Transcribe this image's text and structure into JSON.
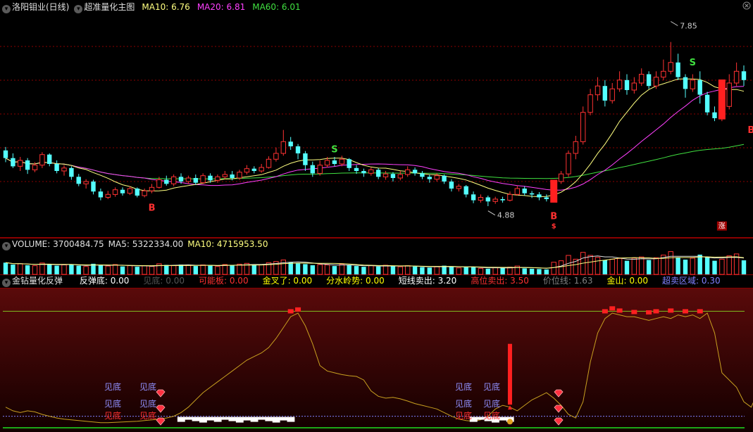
{
  "main_header": {
    "stock": "洛阳钼业(日线)",
    "indicator": "超准量化主图",
    "ma10": "MA10: 6.76",
    "ma20": "MA20: 6.81",
    "ma60": "MA60: 6.01"
  },
  "volume_header": {
    "volume": "VOLUME: 3700484.75",
    "ma5": "MA5: 5322334.00",
    "ma10": "MA10: 4715953.50"
  },
  "osc_header": {
    "name": "金钻量化反弹",
    "items": [
      {
        "label": "反弹底: 0.00",
        "color": "#ffffff"
      },
      {
        "label": "见底: 0.00",
        "color": "#555555"
      },
      {
        "label": "可能板: 0.00",
        "color": "#ff3030"
      },
      {
        "label": "金叉了: 0.00",
        "color": "#ffff00"
      },
      {
        "label": "分水岭势: 0.00",
        "color": "#ffff00"
      },
      {
        "label": "短线卖出: 3.20",
        "color": "#ffffff"
      },
      {
        "label": "高位卖出: 3.50",
        "color": "#ff3030"
      },
      {
        "label": "价位线: 1.63",
        "color": "#808080"
      },
      {
        "label": "金山: 0.00",
        "color": "#ffff00"
      },
      {
        "label": "超卖区域: 0.30",
        "color": "#8080ff"
      }
    ]
  },
  "colors": {
    "up": "#ff3232",
    "down": "#54ffff",
    "ma10": "#ffff80",
    "ma20": "#ff40ff",
    "ma60": "#40e040",
    "grid": "#8b0000"
  },
  "chart_data": {
    "type": "candlestick",
    "high_label": "7.85",
    "low_label": "4.88",
    "signals": {
      "buy": "B",
      "sell": "S",
      "small_sell": "$",
      "zhang": "涨"
    },
    "osc_labels": {
      "jiandi": "见底"
    },
    "candles": [
      [
        5.75,
        5.62,
        5.81,
        5.55
      ],
      [
        5.62,
        5.48,
        5.7,
        5.45
      ],
      [
        5.48,
        5.58,
        5.64,
        5.4
      ],
      [
        5.58,
        5.42,
        5.62,
        5.35
      ],
      [
        5.42,
        5.5,
        5.55,
        5.38
      ],
      [
        5.5,
        5.68,
        5.72,
        5.45
      ],
      [
        5.68,
        5.52,
        5.7,
        5.48
      ],
      [
        5.52,
        5.4,
        5.58,
        5.36
      ],
      [
        5.4,
        5.45,
        5.5,
        5.32
      ],
      [
        5.45,
        5.3,
        5.48,
        5.25
      ],
      [
        5.3,
        5.18,
        5.35,
        5.14
      ],
      [
        5.18,
        5.22,
        5.26,
        5.1
      ],
      [
        5.22,
        5.05,
        5.25,
        5.0
      ],
      [
        5.05,
        4.95,
        5.1,
        4.9
      ],
      [
        4.95,
        5.0,
        5.06,
        4.92
      ],
      [
        5.0,
        5.08,
        5.12,
        4.96
      ],
      [
        5.08,
        5.02,
        5.12,
        4.98
      ],
      [
        5.02,
        5.1,
        5.14,
        4.99
      ],
      [
        5.1,
        4.98,
        5.12,
        4.95
      ],
      [
        4.98,
        5.06,
        5.1,
        4.95
      ],
      [
        5.06,
        5.12,
        5.18,
        5.02
      ],
      [
        5.12,
        5.25,
        5.3,
        5.1
      ],
      [
        5.25,
        5.18,
        5.32,
        5.15
      ],
      [
        5.18,
        5.3,
        5.34,
        5.14
      ],
      [
        5.3,
        5.22,
        5.36,
        5.18
      ],
      [
        5.22,
        5.28,
        5.32,
        5.18
      ],
      [
        5.28,
        5.2,
        5.34,
        5.16
      ],
      [
        5.2,
        5.32,
        5.36,
        5.18
      ],
      [
        5.32,
        5.24,
        5.36,
        5.2
      ],
      [
        5.24,
        5.3,
        5.34,
        5.2
      ],
      [
        5.3,
        5.34,
        5.4,
        5.26
      ],
      [
        5.34,
        5.28,
        5.4,
        5.24
      ],
      [
        5.28,
        5.38,
        5.42,
        5.25
      ],
      [
        5.38,
        5.44,
        5.5,
        5.34
      ],
      [
        5.44,
        5.4,
        5.48,
        5.36
      ],
      [
        5.4,
        5.46,
        5.52,
        5.37
      ],
      [
        5.46,
        5.6,
        5.65,
        5.44
      ],
      [
        5.6,
        5.7,
        5.8,
        5.56
      ],
      [
        5.7,
        5.9,
        6.1,
        5.66
      ],
      [
        5.9,
        5.82,
        5.98,
        5.76
      ],
      [
        5.82,
        5.7,
        5.86,
        5.6
      ],
      [
        5.7,
        5.5,
        5.74,
        5.4
      ],
      [
        5.5,
        5.36,
        5.56,
        5.3
      ],
      [
        5.36,
        5.5,
        5.58,
        5.32
      ],
      [
        5.5,
        5.58,
        5.64,
        5.46
      ],
      [
        5.58,
        5.52,
        5.64,
        5.48
      ],
      [
        5.52,
        5.6,
        5.66,
        5.48
      ],
      [
        5.6,
        5.45,
        5.62,
        5.4
      ],
      [
        5.45,
        5.4,
        5.5,
        5.35
      ],
      [
        5.4,
        5.36,
        5.44,
        5.3
      ],
      [
        5.36,
        5.42,
        5.46,
        5.32
      ],
      [
        5.42,
        5.3,
        5.45,
        5.26
      ],
      [
        5.3,
        5.35,
        5.4,
        5.25
      ],
      [
        5.35,
        5.28,
        5.38,
        5.22
      ],
      [
        5.28,
        5.34,
        5.4,
        5.24
      ],
      [
        5.34,
        5.42,
        5.48,
        5.3
      ],
      [
        5.42,
        5.36,
        5.46,
        5.32
      ],
      [
        5.36,
        5.3,
        5.4,
        5.26
      ],
      [
        5.3,
        5.26,
        5.34,
        5.2
      ],
      [
        5.26,
        5.32,
        5.36,
        5.22
      ],
      [
        5.32,
        5.22,
        5.34,
        5.18
      ],
      [
        5.22,
        5.1,
        5.26,
        5.05
      ],
      [
        5.1,
        5.14,
        5.18,
        5.05
      ],
      [
        5.14,
        5.0,
        5.16,
        4.95
      ],
      [
        5.0,
        4.9,
        5.05,
        4.85
      ],
      [
        4.9,
        4.95,
        5.0,
        4.86
      ],
      [
        4.95,
        4.88,
        4.98,
        4.8
      ],
      [
        4.88,
        4.92,
        4.96,
        4.84
      ],
      [
        4.92,
        4.9,
        4.96,
        4.86
      ],
      [
        4.9,
        5.0,
        5.05,
        4.88
      ],
      [
        5.0,
        5.1,
        5.15,
        4.98
      ],
      [
        5.1,
        5.02,
        5.14,
        4.98
      ],
      [
        5.02,
        5.0,
        5.06,
        4.94
      ],
      [
        5.0,
        4.95,
        5.04,
        4.9
      ],
      [
        4.95,
        4.92,
        5.0,
        4.88
      ],
      [
        4.92,
        5.22,
        5.25,
        4.9
      ],
      [
        5.22,
        5.35,
        5.4,
        5.18
      ],
      [
        5.35,
        5.7,
        5.75,
        5.3
      ],
      [
        5.7,
        5.9,
        6.0,
        5.6
      ],
      [
        5.9,
        6.4,
        6.5,
        5.85
      ],
      [
        6.4,
        6.7,
        6.8,
        6.35
      ],
      [
        6.7,
        6.85,
        7.0,
        6.6
      ],
      [
        6.85,
        6.6,
        6.95,
        6.5
      ],
      [
        6.6,
        6.8,
        6.9,
        6.55
      ],
      [
        6.8,
        6.95,
        7.1,
        6.75
      ],
      [
        6.95,
        6.78,
        7.05,
        6.7
      ],
      [
        6.78,
        6.9,
        7.0,
        6.72
      ],
      [
        6.9,
        7.05,
        7.15,
        6.85
      ],
      [
        7.05,
        6.85,
        7.1,
        6.8
      ],
      [
        6.85,
        7.0,
        7.1,
        6.8
      ],
      [
        7.0,
        7.1,
        7.3,
        6.95
      ],
      [
        7.1,
        7.25,
        7.6,
        7.05
      ],
      [
        7.25,
        7.0,
        7.4,
        6.95
      ],
      [
        7.0,
        6.8,
        7.05,
        6.65
      ],
      [
        6.8,
        6.95,
        7.05,
        6.75
      ],
      [
        6.95,
        6.7,
        7.1,
        6.55
      ],
      [
        6.7,
        6.4,
        6.75,
        6.35
      ],
      [
        6.4,
        6.3,
        6.5,
        6.25
      ],
      [
        6.3,
        6.5,
        6.6,
        6.25
      ],
      [
        6.5,
        6.9,
        7.05,
        6.45
      ],
      [
        6.9,
        7.1,
        7.25,
        6.85
      ],
      [
        7.1,
        6.95,
        7.2,
        6.85
      ]
    ],
    "volume": [
      3.1,
      2.6,
      2.8,
      2.4,
      2.3,
      3.0,
      2.7,
      2.3,
      2.5,
      2.6,
      2.3,
      2.1,
      2.8,
      2.4,
      2.2,
      2.6,
      2.1,
      2.3,
      2.0,
      2.3,
      2.1,
      2.8,
      2.5,
      2.3,
      2.6,
      2.4,
      2.2,
      2.5,
      2.3,
      2.1,
      2.6,
      2.5,
      2.7,
      2.9,
      2.4,
      2.6,
      3.1,
      3.4,
      3.8,
      3.2,
      3.0,
      2.7,
      2.4,
      2.6,
      2.5,
      2.2,
      2.7,
      2.4,
      2.2,
      2.0,
      2.3,
      2.1,
      2.4,
      2.2,
      2.0,
      2.3,
      2.1,
      1.9,
      1.8,
      2.0,
      2.3,
      2.1,
      1.7,
      1.9,
      2.0,
      1.6,
      1.5,
      1.8,
      1.7,
      1.9,
      2.2,
      1.6,
      1.5,
      1.4,
      1.3,
      3.2,
      3.6,
      5.0,
      4.0,
      5.8,
      5.0,
      4.5,
      3.8,
      4.0,
      4.2,
      3.6,
      4.3,
      4.6,
      3.8,
      4.4,
      5.1,
      6.0,
      4.5,
      3.9,
      4.3,
      5.2,
      4.6,
      3.6,
      4.0,
      4.9,
      5.4,
      3.7
    ],
    "osc_line": [
      0.55,
      0.45,
      0.4,
      0.45,
      0.42,
      0.35,
      0.3,
      0.25,
      0.22,
      0.2,
      0.18,
      0.16,
      0.14,
      0.12,
      0.12,
      0.13,
      0.14,
      0.15,
      0.16,
      0.18,
      0.2,
      0.22,
      0.25,
      0.3,
      0.4,
      0.55,
      0.75,
      0.95,
      1.1,
      1.25,
      1.4,
      1.55,
      1.7,
      1.85,
      1.95,
      2.05,
      2.2,
      2.45,
      2.75,
      3.05,
      3.15,
      2.8,
      2.3,
      1.7,
      1.55,
      1.5,
      1.45,
      1.42,
      1.4,
      1.3,
      1.0,
      0.85,
      0.8,
      0.82,
      0.78,
      0.72,
      0.65,
      0.6,
      0.55,
      0.5,
      0.4,
      0.3,
      0.22,
      0.18,
      0.16,
      0.2,
      0.3,
      0.5,
      0.6,
      0.55,
      0.45,
      0.6,
      0.75,
      0.85,
      0.95,
      0.8,
      0.6,
      0.35,
      0.25,
      0.7,
      1.8,
      2.6,
      3.0,
      3.15,
      3.1,
      3.05,
      3.05,
      3.0,
      2.95,
      3.0,
      3.05,
      3.0,
      3.1,
      3.05,
      3.1,
      3.0,
      3.15,
      2.6,
      1.5,
      1.3,
      1.1,
      0.7,
      0.55,
      1.0,
      1.4,
      1.3
    ],
    "ylim_price": [
      4.5,
      8.1
    ],
    "ylim_osc": [
      0,
      3.5
    ]
  }
}
